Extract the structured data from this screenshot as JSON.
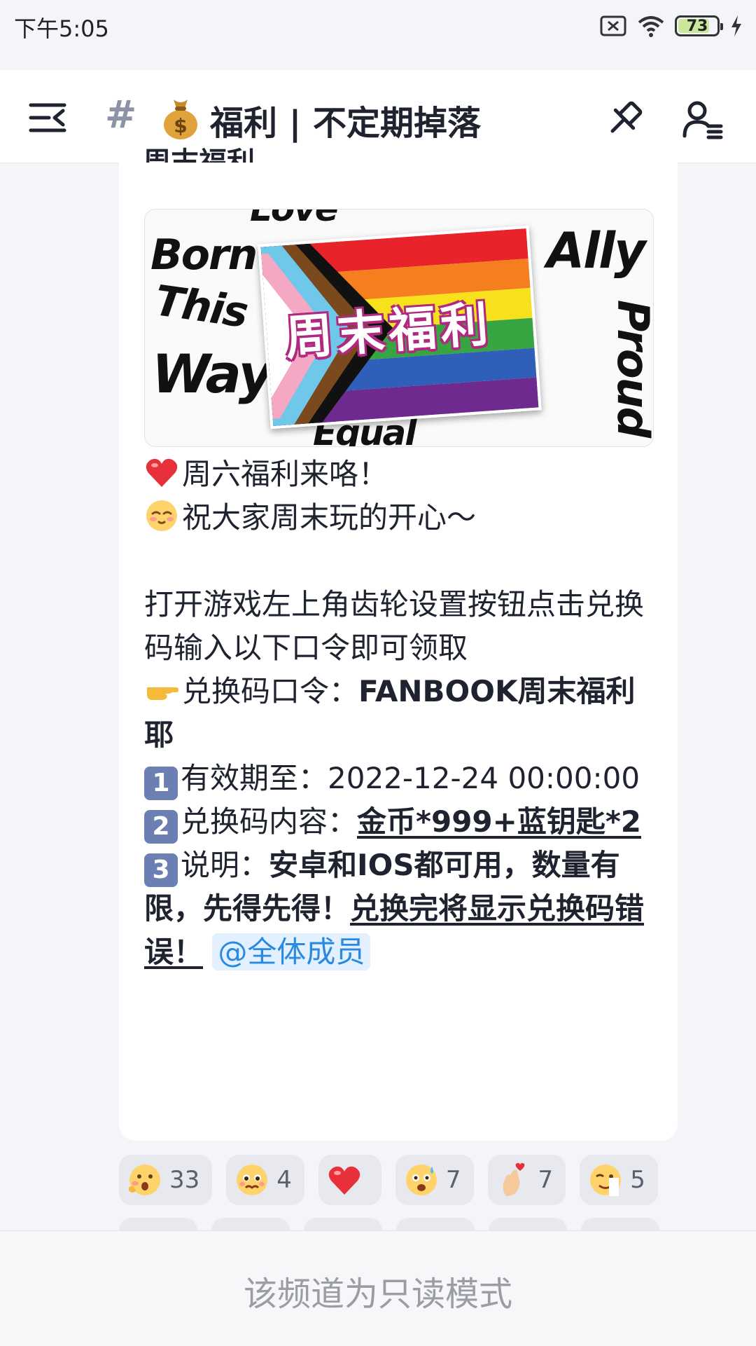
{
  "status_bar": {
    "time": "下午5:05",
    "battery": "73"
  },
  "header": {
    "hash": "#",
    "emoji": "money-bag",
    "title": "福利 | 不定期掉落"
  },
  "post": {
    "cut_title": "周末福利",
    "banner": {
      "title": "周末福利",
      "background_words": [
        "Born",
        "This",
        "Way",
        "Ally",
        "Proud",
        "Love",
        "Equal"
      ]
    },
    "lines": {
      "l1": "周六福利来咯！",
      "l2": "祝大家周末玩的开心～",
      "l3": "打开游戏左上角齿轮设置按钮点击兑换码输入以下口令即可领取",
      "l4_label": "兑换码口令：",
      "l4_value": "FANBOOK周末福利耶",
      "n1": "1",
      "l5_label": "有效期至：",
      "l5_value": "2022-12-24 00:00:00",
      "n2": "2",
      "l6_label": "兑换码内容：",
      "l6_value": "金币*999+蓝钥匙*2",
      "n3": "3",
      "l7_label": "说明：",
      "l7_bold": "安卓和IOS都可用，数量有限，先得先得！",
      "l7_underline": "兑换完将显示兑换码错误！",
      "mention": "@全体成员"
    }
  },
  "reactions": [
    {
      "icon": "surprised-face-icon",
      "count": "33"
    },
    {
      "icon": "pleading-face-icon",
      "count": "4"
    },
    {
      "icon": "heart-icon",
      "count": ""
    },
    {
      "icon": "anxious-face-icon",
      "count": "7"
    },
    {
      "icon": "finger-heart-icon",
      "count": "7"
    },
    {
      "icon": "winking-face-icon",
      "count": "5"
    }
  ],
  "footer": {
    "readonly": "该频道为只读模式"
  },
  "colors": {
    "accent": "#2a8ae0",
    "number_badge": "#6b7fb3",
    "mention_bg": "#e3f0ff"
  }
}
